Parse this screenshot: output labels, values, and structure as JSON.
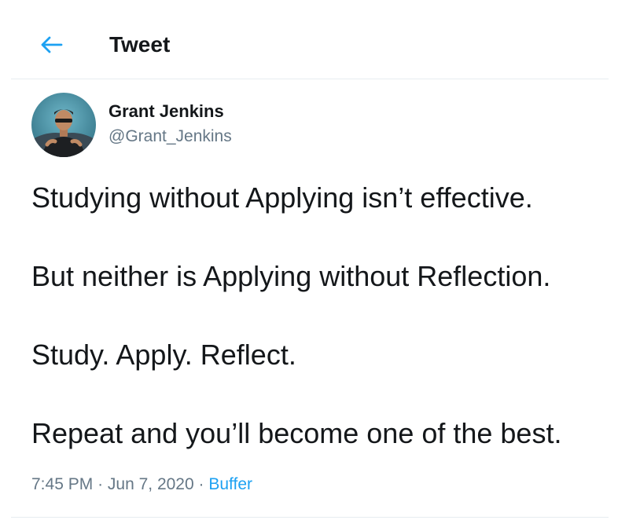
{
  "header": {
    "title": "Tweet",
    "back_icon": "arrow-left-icon",
    "accent_color": "#1da1f2"
  },
  "author": {
    "name": "Grant Jenkins",
    "handle": "@Grant_Jenkins",
    "avatar_icon": "profile-photo"
  },
  "tweet": {
    "lines": [
      "Studying without Applying isn’t effective.",
      "But neither is Applying without Reflection.",
      "Study. Apply. Reflect.",
      "Repeat and you’ll become one of the best."
    ],
    "time": "7:45 PM",
    "date": "Jun 7, 2020",
    "source": "Buffer",
    "separator": "·"
  }
}
